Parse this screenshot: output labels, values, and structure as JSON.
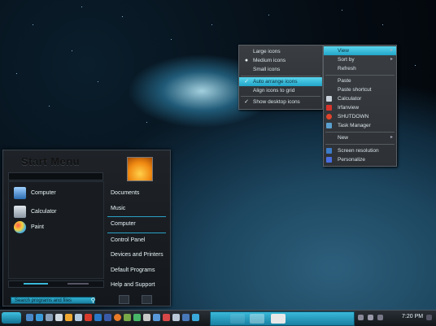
{
  "start_menu": {
    "title": "Start Menu",
    "pinned_apps": [
      {
        "label": "Computer",
        "icon": "computer-icon"
      },
      {
        "label": "Calculator",
        "icon": "calculator-icon"
      },
      {
        "label": "Paint",
        "icon": "paint-icon"
      }
    ],
    "right_links": [
      "Documents",
      "Music",
      "Computer",
      "Control Panel",
      "Devices and Printers",
      "Default Programs",
      "Help and Support"
    ],
    "search_placeholder": "Search programs and files"
  },
  "view_submenu": {
    "items": [
      "Large icons",
      "Medium icons",
      "Small icons",
      "Auto arrange icons",
      "Align icons to grid",
      "Show desktop icons"
    ]
  },
  "context_menu": {
    "items": [
      "View",
      "Sort by",
      "Refresh",
      "Paste",
      "Paste shortcut",
      "Calculator",
      "Irfanview",
      "SHUTDOWN",
      "Task Manager",
      "New",
      "Screen resolution",
      "Personalize"
    ]
  },
  "taskbar": {
    "clock": "7:20 PM"
  },
  "colors": {
    "accent": "#2fb6d8",
    "menu_bg": "#34383c"
  }
}
